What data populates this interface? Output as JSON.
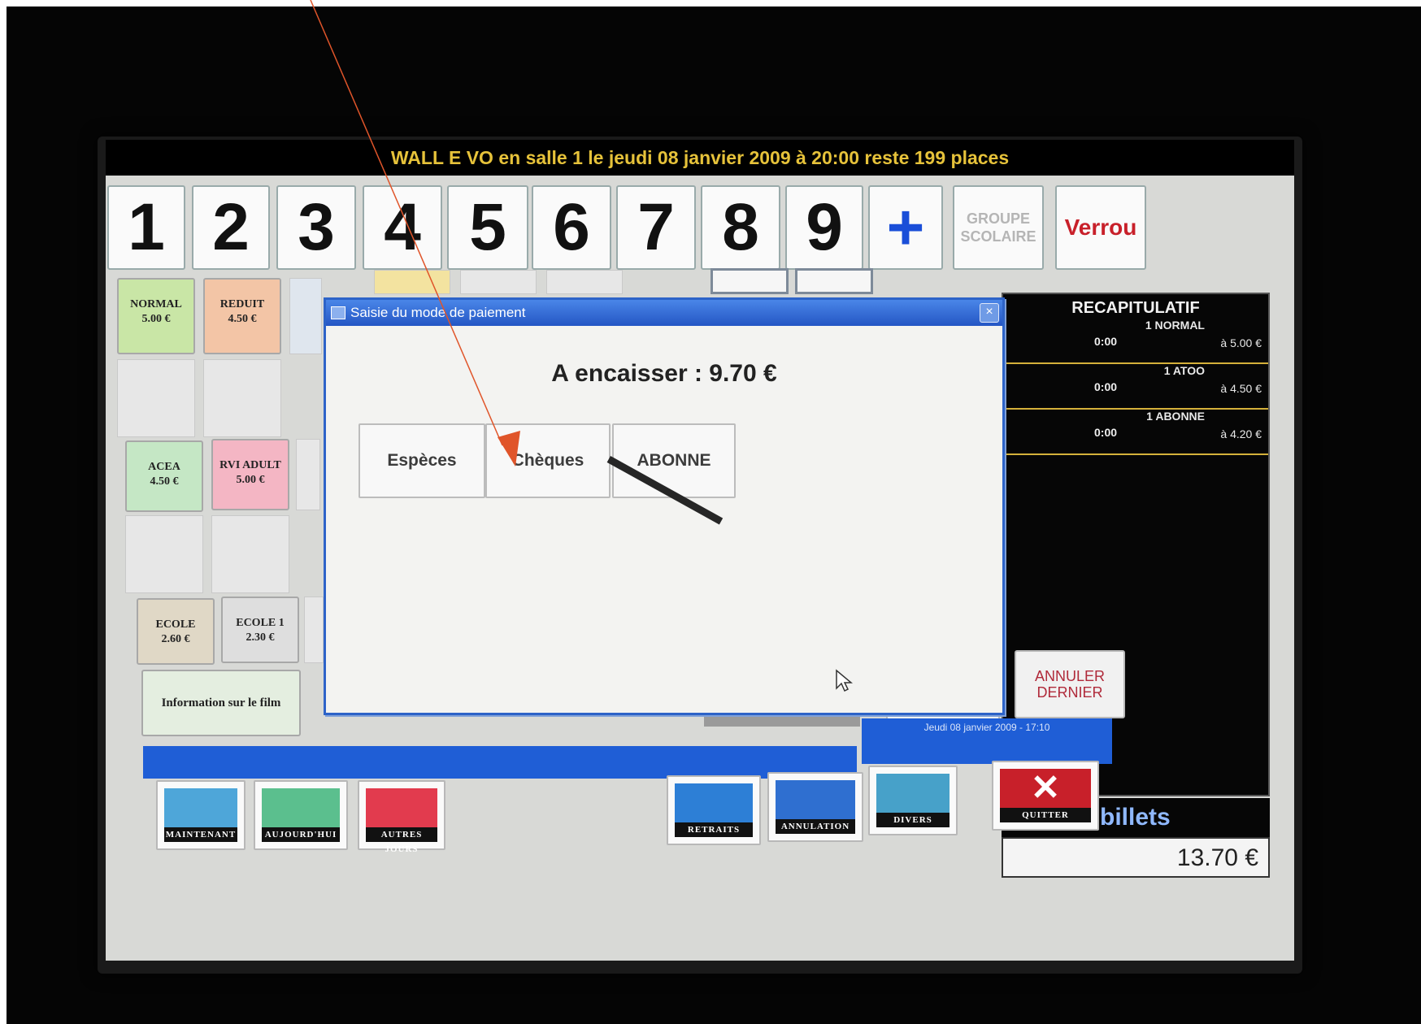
{
  "screen": {
    "top_banner": "WALL E  VO en salle 1 le jeudi 08 janvier 2009 à 20:00 reste 199 places",
    "numpad": [
      "1",
      "2",
      "3",
      "4",
      "5",
      "6",
      "7",
      "8",
      "9"
    ],
    "plus_label": "+",
    "groupe_label": "GROUPE\nSCOLAIRE",
    "verrou_label": "Verrou"
  },
  "tariffs": [
    {
      "name": "NORMAL",
      "price": "5.00 €",
      "color": "#c9e6a6"
    },
    {
      "name": "REDUIT",
      "price": "4.50 €",
      "color": "#f3c5a6"
    },
    {
      "name": "ACEA",
      "price": "4.50 €",
      "color": "#c5e7c5"
    },
    {
      "name": "RVI ADULT",
      "price": "5.00 €",
      "color": "#f4b6c4"
    },
    {
      "name": "ECOLE",
      "price": "2.60 €",
      "color": "#e0d8c6"
    },
    {
      "name": "ECOLE 1",
      "price": "2.30 €",
      "color": "#dedede"
    }
  ],
  "info_film": "Information sur le film",
  "recap": {
    "title": "RECAPITULATIF",
    "rows": [
      {
        "time": "0:00",
        "qty": "1 NORMAL",
        "price": "à 5.00 €"
      },
      {
        "time": "0:00",
        "qty": "1 ATOO",
        "price": "à 4.50 €"
      },
      {
        "time": "0:00",
        "qty": "1 ABONNE",
        "price": "à 4.20 €"
      }
    ],
    "billets": "3 billets",
    "total": "13.70 €"
  },
  "buttons": {
    "annuler_left_partial": "ER",
    "annuler_dernier": "ANNULER\nDERNIER"
  },
  "status_date": "Jeudi 08 janvier 2009 - 17:10",
  "bottom_icons": [
    {
      "label": "MAINTENANT",
      "color": "#4ea6d9"
    },
    {
      "label": "AUJOURD'HUI",
      "color": "#5bbf8e"
    },
    {
      "label": "AUTRES JOURS",
      "color": "#e23b4e"
    },
    {
      "label": "RETRAITS",
      "color": "#2d7fd6"
    },
    {
      "label": "ANNULATION",
      "color": "#2f6fd0"
    },
    {
      "label": "DIVERS",
      "color": "#47a1c9"
    },
    {
      "label": "QUITTER",
      "color": "#c8202a"
    }
  ],
  "dialog": {
    "title": "Saisie du mode de paiement",
    "close_label": "×",
    "amount": "A encaisser : 9.70 €",
    "buttons": [
      "Espèces",
      "Chèques",
      "ABONNE"
    ]
  },
  "colors": {
    "accent": "#1f5ed6",
    "arrow": "#e0552a",
    "banner_text": "#e6c23a"
  }
}
